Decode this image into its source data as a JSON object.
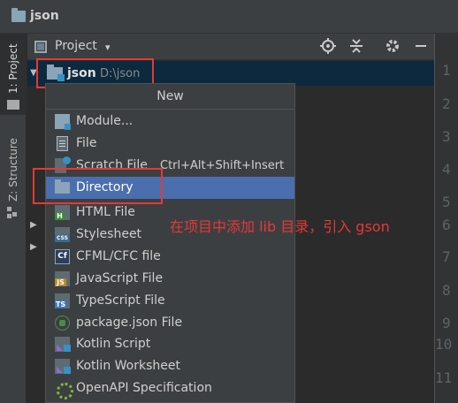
{
  "window": {
    "title": "json"
  },
  "left_strip": {
    "project_tab": "1: Project",
    "structure_tab": "Z: Structure"
  },
  "project_header": {
    "label": "Project",
    "dropdown": "▾"
  },
  "tree": {
    "root_name": "json",
    "root_path": "D:\\json"
  },
  "gutter_numbers": [
    "1",
    "2",
    "3",
    "4",
    "5",
    "6",
    "7",
    "8",
    "9",
    "10",
    "11"
  ],
  "popup": {
    "title": "New",
    "items": [
      {
        "label": "Module...",
        "icon": "module-icon"
      },
      {
        "label": "File",
        "icon": "file-icon"
      },
      {
        "label": "Scratch File",
        "shortcut": "Ctrl+Alt+Shift+Insert",
        "icon": "scratch-file-icon"
      },
      {
        "label": "Directory",
        "icon": "folder-icon",
        "selected": true
      },
      {
        "label": "HTML File",
        "icon": "html-file-icon",
        "badge": "H"
      },
      {
        "label": "Stylesheet",
        "icon": "css-file-icon",
        "badge": "CSS"
      },
      {
        "label": "CFML/CFC file",
        "icon": "cfml-file-icon",
        "badge": "Cf"
      },
      {
        "label": "JavaScript File",
        "icon": "javascript-file-icon",
        "badge": "JS"
      },
      {
        "label": "TypeScript File",
        "icon": "typescript-file-icon",
        "badge": "TS"
      },
      {
        "label": "package.json File",
        "icon": "npm-package-icon"
      },
      {
        "label": "Kotlin Script",
        "icon": "kotlin-script-icon"
      },
      {
        "label": "Kotlin Worksheet",
        "icon": "kotlin-worksheet-icon"
      },
      {
        "label": "OpenAPI Specification",
        "icon": "openapi-icon"
      }
    ]
  },
  "annotation": "在项目中添加  lib 目录，引入 gson",
  "colors": {
    "selection": "#4b6eaf",
    "highlight_box": "#e53935",
    "background": "#2b2b2b",
    "panel": "#3c3f41"
  }
}
